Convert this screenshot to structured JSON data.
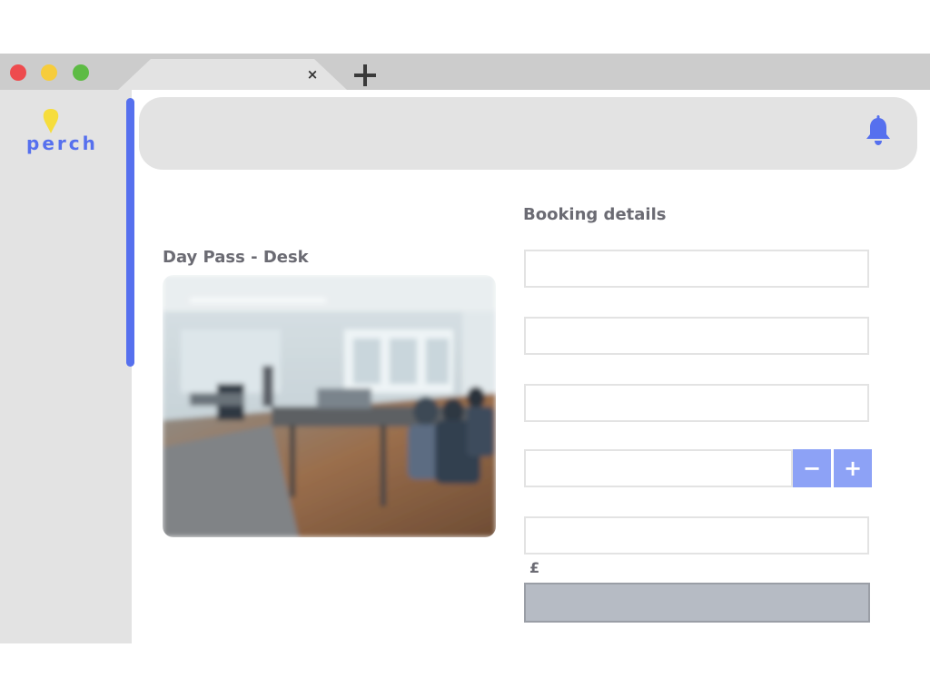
{
  "browser": {
    "tab_close_label": "×",
    "traffic_lights": {
      "close": "#ee4b4e",
      "minimize": "#f6cc3c",
      "maximize": "#5dbb44"
    }
  },
  "sidebar": {
    "logo_text": "perch",
    "logo_pin_color": "#f6dd3c",
    "accent_color": "#5670ee"
  },
  "header": {
    "notification_icon": "bell-icon"
  },
  "listing": {
    "title": "Day Pass - Desk",
    "image_description_icon": "office-photo"
  },
  "booking": {
    "title": "Booking details",
    "fields": [
      {
        "value": "",
        "placeholder": ""
      },
      {
        "value": "",
        "placeholder": ""
      },
      {
        "value": "",
        "placeholder": ""
      },
      {
        "value": "",
        "placeholder": ""
      },
      {
        "value": "",
        "placeholder": ""
      }
    ],
    "stepper": {
      "minus_label": "−",
      "plus_label": "+"
    },
    "currency_symbol": "£",
    "button_color": "#8da2f6"
  }
}
